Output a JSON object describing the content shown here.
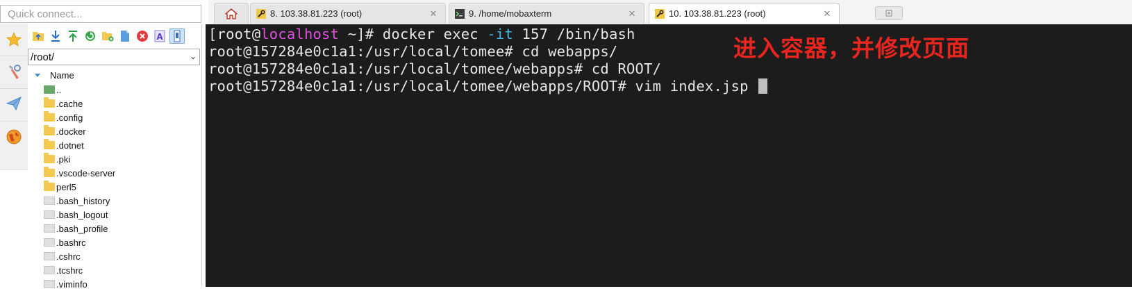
{
  "quick_connect": {
    "placeholder": "Quick connect..."
  },
  "tabs": [
    {
      "icon": "home-icon",
      "label": ""
    },
    {
      "icon": "key-icon",
      "label": "8. 103.38.81.223 (root)",
      "close": "✕"
    },
    {
      "icon": "terminal-icon",
      "label": "9. /home/mobaxterm",
      "close": "✕"
    },
    {
      "icon": "key-icon",
      "label": "10. 103.38.81.223 (root)",
      "close": "✕",
      "active": true
    }
  ],
  "new_tab_icon": "plus-tab-icon",
  "rail": [
    "star-icon",
    "tools-icon",
    "paper-plane-icon",
    "globe-icon"
  ],
  "sftp": {
    "toolbar": [
      "folder-up-icon",
      "download-icon",
      "upload-icon",
      "refresh-icon",
      "new-folder-icon",
      "new-file-icon",
      "delete-icon",
      "rename-icon",
      "follow-terminal-icon"
    ],
    "path": "/root/",
    "column_header": "Name",
    "files": [
      {
        "name": "..",
        "type": "up"
      },
      {
        "name": ".cache",
        "type": "folder"
      },
      {
        "name": ".config",
        "type": "folder"
      },
      {
        "name": ".docker",
        "type": "folder"
      },
      {
        "name": ".dotnet",
        "type": "folder"
      },
      {
        "name": ".pki",
        "type": "folder"
      },
      {
        "name": ".vscode-server",
        "type": "folder"
      },
      {
        "name": "perl5",
        "type": "folder"
      },
      {
        "name": ".bash_history",
        "type": "file"
      },
      {
        "name": ".bash_logout",
        "type": "file"
      },
      {
        "name": ".bash_profile",
        "type": "file"
      },
      {
        "name": ".bashrc",
        "type": "file"
      },
      {
        "name": ".cshrc",
        "type": "file"
      },
      {
        "name": ".tcshrc",
        "type": "file"
      },
      {
        "name": ".viminfo",
        "type": "file"
      }
    ]
  },
  "terminal": {
    "line1": {
      "prefix": "[root@",
      "host": "localhost",
      "mid": " ~]# docker exec ",
      "flag": "-it",
      "rest": " 157 /bin/bash"
    },
    "line2": "root@157284e0c1a1:/usr/local/tomee# cd webapps/",
    "line3": "root@157284e0c1a1:/usr/local/tomee/webapps# cd ROOT/",
    "line4": "root@157284e0c1a1:/usr/local/tomee/webapps/ROOT# vim index.jsp ",
    "annotation": "进入容器，并修改页面"
  },
  "colors": {
    "terminal_bg": "#1c1c1c",
    "host": "#e04ee0",
    "flag": "#3fb6e6",
    "annotation": "#e8251e"
  }
}
